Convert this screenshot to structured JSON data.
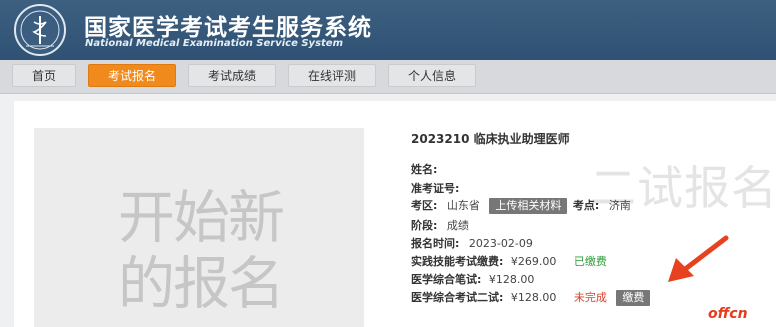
{
  "header": {
    "title": "国家医学考试考生服务系统",
    "subtitle": "National Medical Examination Service System"
  },
  "nav": [
    {
      "label": "首页"
    },
    {
      "label": "考试报名"
    },
    {
      "label": "考试成绩"
    },
    {
      "label": "在线评测"
    },
    {
      "label": "个人信息"
    }
  ],
  "placeholder": {
    "text": "开始新的报名"
  },
  "watermark": "二试报名",
  "exam": {
    "title": "2023210 临床执业助理医师",
    "name_label": "姓名:",
    "ticket_label": "准考证号:",
    "region_label": "考区:",
    "region_value": "山东省",
    "upload_button": "上传相关材料",
    "site_label": "考点:",
    "site_value": "济南",
    "stage_label": "阶段:",
    "stage_value": "成绩",
    "signup_time_label": "报名时间:",
    "signup_time_value": "2023-02-09",
    "practical_fee_label": "实践技能考试缴费:",
    "practical_fee_value": "¥269.00",
    "practical_fee_status": "已缴费",
    "written_label": "医学综合笔试:",
    "written_value": "¥128.00",
    "second_label": "医学综合考试二试:",
    "second_value": "¥128.00",
    "second_status": "未完成",
    "pay_button": "缴费"
  },
  "brand_mark": "offcn",
  "colors": {
    "header_bg": "#2f5173",
    "nav_active": "#f08a1c",
    "paid": "#2e9e37",
    "unpaid": "#d3432c",
    "arrow": "#e8411f"
  }
}
